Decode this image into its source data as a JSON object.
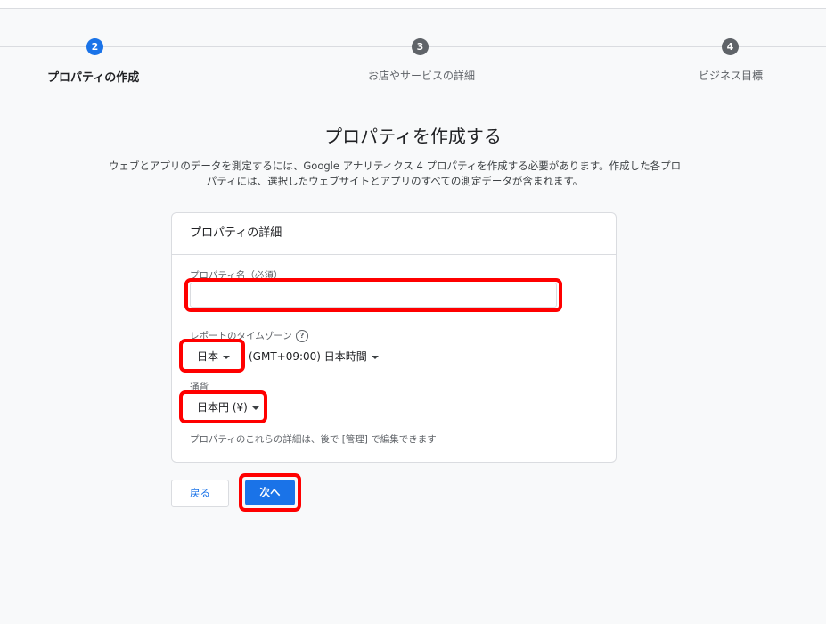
{
  "colors": {
    "accent": "#1a73e8",
    "step_inactive": "#5f6368",
    "annotation": "#ff0000"
  },
  "stepper": {
    "steps": [
      {
        "number": "2",
        "label": "プロパティの作成",
        "state": "active"
      },
      {
        "number": "3",
        "label": "お店やサービスの詳細",
        "state": "inactive"
      },
      {
        "number": "4",
        "label": "ビジネス目標",
        "state": "inactive"
      }
    ]
  },
  "heading": {
    "title": "プロパティを作成する",
    "description_line1": "ウェブとアプリのデータを測定するには、Google アナリティクス 4 プロパティを作成する必要があります。作成した各プロ",
    "description_line2": "パティには、選択したウェブサイトとアプリのすべての測定データが含まれます。"
  },
  "card": {
    "title": "プロパティの詳細",
    "property_name": {
      "label": "プロパティ名（必須）",
      "value": ""
    },
    "timezone": {
      "label": "レポートのタイムゾーン",
      "help_icon": "help-circle-icon",
      "country": "日本",
      "zone": "(GMT+09:00) 日本時間"
    },
    "currency": {
      "label": "通貨",
      "value": "日本円 (¥)"
    },
    "note": "プロパティのこれらの詳細は、後で [管理] で編集できます"
  },
  "actions": {
    "back_label": "戻る",
    "next_label": "次へ"
  }
}
